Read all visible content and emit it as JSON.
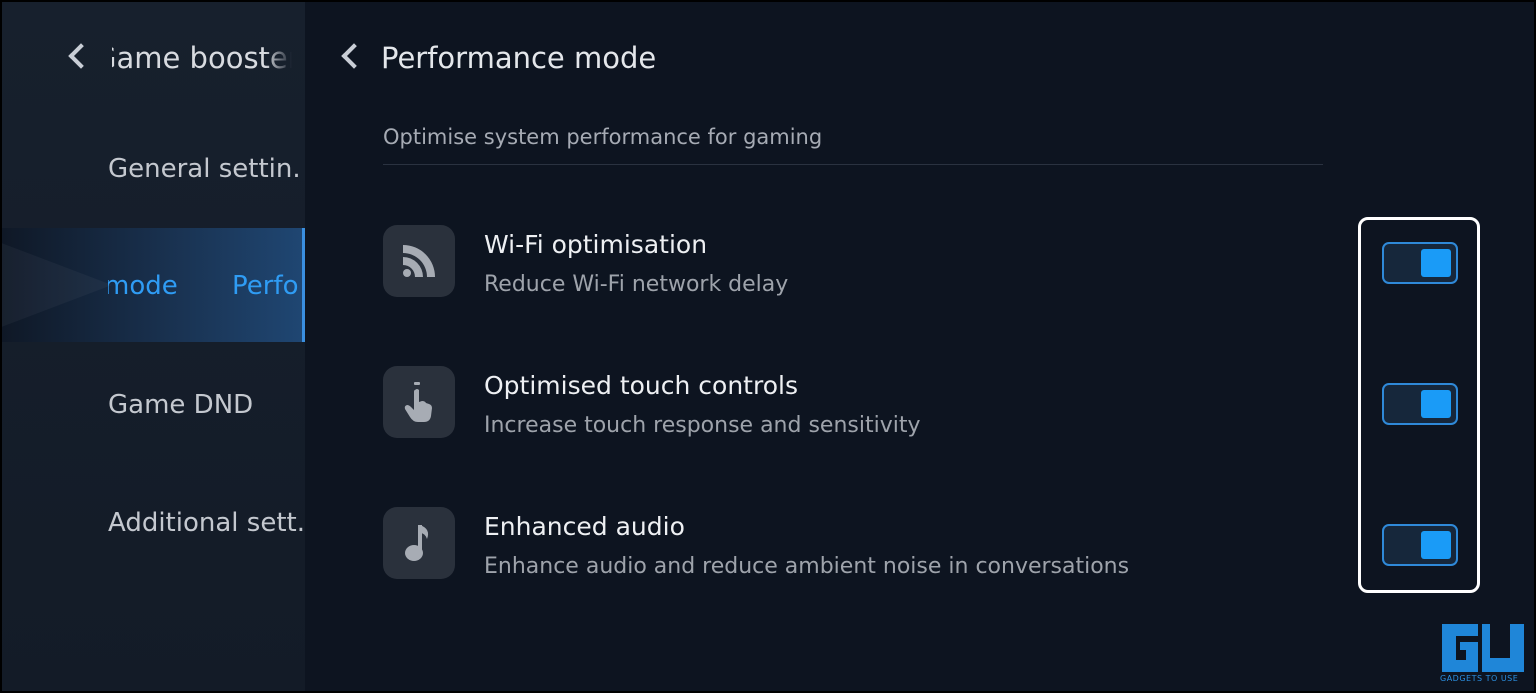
{
  "sidebar": {
    "title": "Game booster settings",
    "items": [
      {
        "label": "General settings",
        "display": "General settin.."
      },
      {
        "label": "Performance mode",
        "display_seg1": "mode",
        "display_seg2": "Perfo",
        "active": true
      },
      {
        "label": "Game DND",
        "display": "Game DND"
      },
      {
        "label": "Additional settings",
        "display": "Additional sett.."
      }
    ]
  },
  "header": {
    "title": "Performance mode"
  },
  "main": {
    "subtitle": "Optimise system performance for gaming",
    "options": [
      {
        "title": "Wi-Fi optimisation",
        "description": "Reduce Wi-Fi network delay",
        "icon": "wifi-icon",
        "enabled": true
      },
      {
        "title": "Optimised touch controls",
        "description": "Increase touch response and sensitivity",
        "icon": "touch-icon",
        "enabled": true
      },
      {
        "title": "Enhanced audio",
        "description": "Enhance audio and reduce ambient noise in conversations",
        "icon": "music-note-icon",
        "enabled": true
      }
    ]
  },
  "watermark": {
    "text": "GADGETS TO USE"
  },
  "colors": {
    "accent": "#1a9bf7",
    "background": "#0d1420",
    "sidebar": "#17202d",
    "highlight": "#ffffff"
  }
}
